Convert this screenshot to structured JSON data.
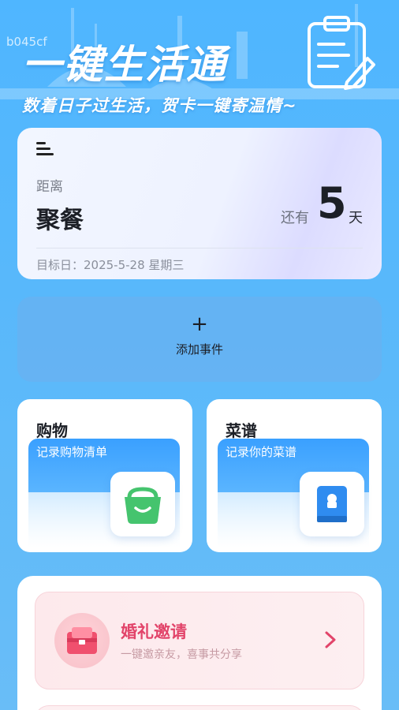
{
  "watermark": "b045cf",
  "hero": {
    "title": "一键生活通",
    "subtitle": "数着日子过生活，贺卡一键寄温情~"
  },
  "countdown": {
    "label": "距离",
    "event": "聚餐",
    "remain_prefix": "还有",
    "days": "5",
    "unit": "天",
    "target_date": "目标日：2025-5-28 星期三"
  },
  "add_event": {
    "plus": "+",
    "label": "添加事件"
  },
  "tiles": [
    {
      "title": "购物",
      "subtitle": "记录购物清单",
      "icon": "shopping-bag-icon",
      "color": "#45c46e"
    },
    {
      "title": "菜谱",
      "subtitle": "记录你的菜谱",
      "icon": "recipe-book-icon",
      "color": "#2f8cf0"
    }
  ],
  "wedding": {
    "title": "婚礼邀请",
    "subtitle": "一键邀亲友，喜事共分享",
    "icon": "invitation-icon",
    "accent": "#e2446a"
  }
}
